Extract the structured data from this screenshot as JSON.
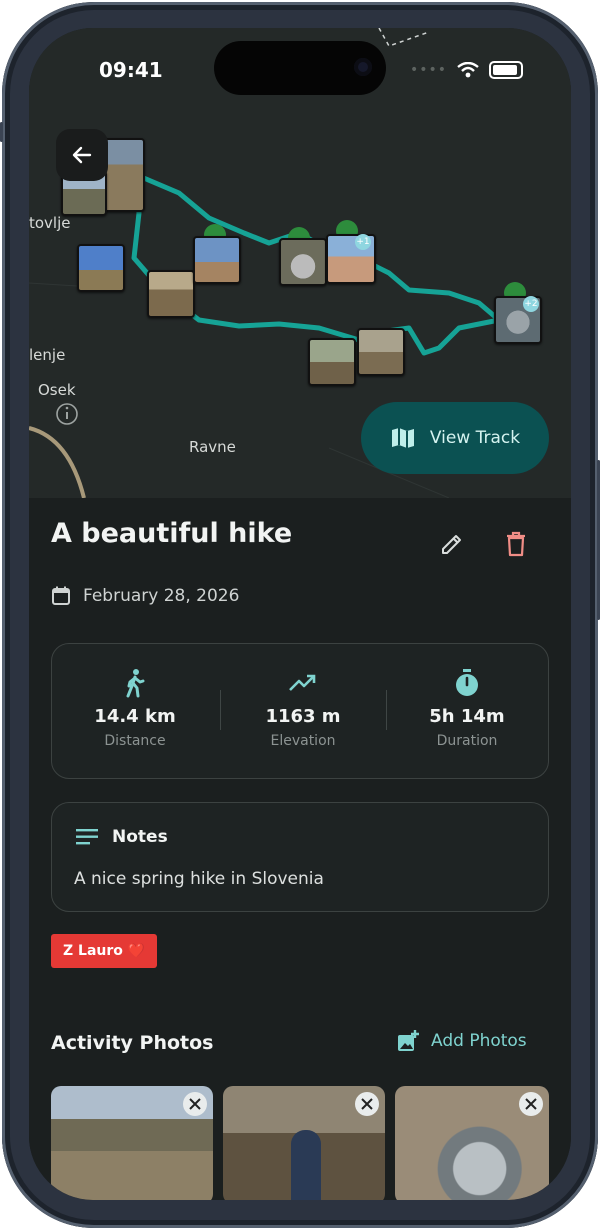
{
  "status": {
    "time": "09:41"
  },
  "map": {
    "labels": [
      "tovlje",
      "lenje",
      "Osek",
      "Ravne"
    ],
    "view_track_label": "View Track",
    "track_color": "#16a396",
    "marker_badges": [
      "+1",
      "+2"
    ]
  },
  "activity": {
    "title": "A beautiful hike",
    "date": "February 28, 2026",
    "stats": [
      {
        "value": "14.4 km",
        "label": "Distance",
        "icon": "walk-icon"
      },
      {
        "value": "1163 m",
        "label": "Elevation",
        "icon": "trending-up-icon"
      },
      {
        "value": "5h 14m",
        "label": "Duration",
        "icon": "stopwatch-icon"
      }
    ],
    "notes_title": "Notes",
    "notes_body": "A nice spring hike in Slovenia",
    "tag": "Z Lauro ❤️",
    "tag_color": "#e53935"
  },
  "photos": {
    "title": "Activity Photos",
    "add_label": "Add Photos"
  },
  "colors": {
    "accent": "#7fd3cf",
    "delete": "#f08d86",
    "background": "#1b1f1f"
  }
}
